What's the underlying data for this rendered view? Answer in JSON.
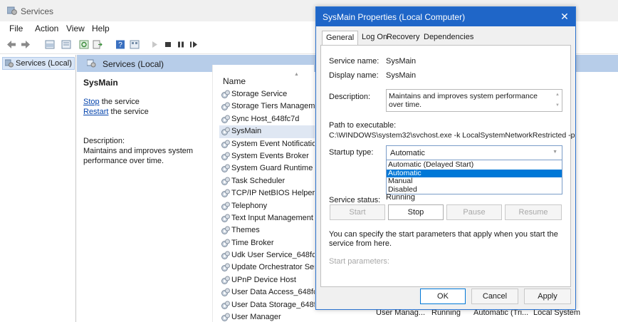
{
  "window": {
    "title": "Services",
    "menu": [
      "File",
      "Action",
      "View",
      "Help"
    ]
  },
  "tree": {
    "node_label": "Services (Local)"
  },
  "content_header": {
    "label": "Services (Local)"
  },
  "details": {
    "service_name": "SysMain",
    "stop_link": "Stop",
    "stop_suffix": " the service",
    "restart_link": "Restart",
    "restart_suffix": " the service",
    "description_label": "Description:",
    "description_text": "Maintains and improves system performance over time."
  },
  "list": {
    "column_name": "Name",
    "selected_index": 3,
    "rows": [
      "Storage Service",
      "Storage Tiers Management",
      "Sync Host_648fc7d",
      "SysMain",
      "System Event Notification Service",
      "System Events Broker",
      "System Guard Runtime Monitor Broker",
      "Task Scheduler",
      "TCP/IP NetBIOS Helper",
      "Telephony",
      "Text Input Management Service",
      "Themes",
      "Time Broker",
      "Udk User Service_648fc7d",
      "Update Orchestrator Service",
      "UPnP Device Host",
      "User Data Access_648fc7d",
      "User Data Storage_648fc7d",
      "User Manager"
    ],
    "last_row_cells": {
      "description": "User Manag...",
      "status": "Running",
      "startup": "Automatic (Tri...",
      "logon": "Local System"
    }
  },
  "dialog": {
    "title": "SysMain Properties (Local Computer)",
    "close_glyph": "✕",
    "tabs": [
      "General",
      "Log On",
      "Recovery",
      "Dependencies"
    ],
    "active_tab": "General",
    "service_name_label": "Service name:",
    "service_name_value": "SysMain",
    "display_name_label": "Display name:",
    "display_name_value": "SysMain",
    "description_label": "Description:",
    "description_value": "Maintains and improves system performance over time.",
    "path_label": "Path to executable:",
    "path_value": "C:\\WINDOWS\\system32\\svchost.exe -k LocalSystemNetworkRestricted -p",
    "startup_type_label": "Startup type:",
    "startup_type_value": "Automatic",
    "startup_options": [
      "Automatic (Delayed Start)",
      "Automatic",
      "Manual",
      "Disabled"
    ],
    "highlighted_option": 1,
    "service_status_label": "Service status:",
    "service_status_value": "Running",
    "buttons": {
      "start": "Start",
      "stop": "Stop",
      "pause": "Pause",
      "resume": "Resume"
    },
    "info_text": "You can specify the start parameters that apply when you start the service from here.",
    "start_parameters_label": "Start parameters:",
    "start_parameters_value": "",
    "footer": {
      "ok": "OK",
      "cancel": "Cancel",
      "apply": "Apply"
    }
  },
  "colors": {
    "dialog_title_bg": "#1f66c8",
    "highlight": "#0078d7",
    "link": "#0645ad",
    "header_bg": "#b7cde9"
  }
}
